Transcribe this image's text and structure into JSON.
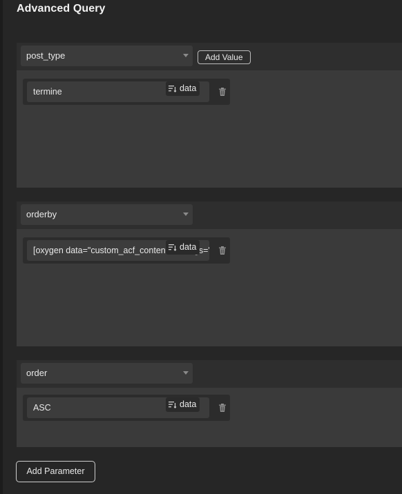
{
  "panel": {
    "title": "Advanced Query"
  },
  "parameters": [
    {
      "key": "post_type",
      "add_value_label": "Add Value",
      "values": [
        {
          "text": "termine",
          "data_label": "data"
        }
      ]
    },
    {
      "key": "orderby",
      "values": [
        {
          "text": "[oxygen data=\"custom_acf_content\" settings='{\"include\":\"termin\"}']",
          "data_label": "data"
        }
      ]
    },
    {
      "key": "order",
      "values": [
        {
          "text": "ASC",
          "data_label": "data"
        }
      ]
    }
  ],
  "footer": {
    "add_parameter_label": "Add Parameter"
  },
  "icons": {
    "select_caret": "chevron-down-icon",
    "data": "dynamic-data-icon",
    "delete": "trash-icon"
  }
}
